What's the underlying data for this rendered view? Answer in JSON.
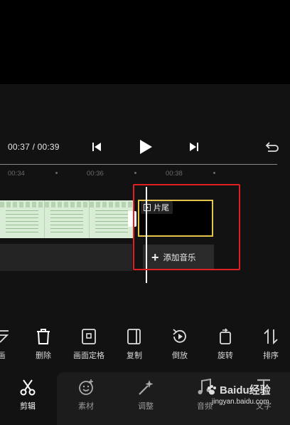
{
  "player": {
    "time_display": "00:37 / 00:39",
    "ruler_ticks": [
      "00:34",
      "00:36",
      "00:38"
    ]
  },
  "timeline": {
    "tail_label": "片尾",
    "add_music_label": "添加音乐",
    "accent_yellow": "#e6c34a",
    "highlight_red": "#e02020"
  },
  "toolbar": {
    "items": [
      {
        "label": "画",
        "icon": "partial-icon"
      },
      {
        "label": "删除",
        "icon": "trash-icon"
      },
      {
        "label": "画面定格",
        "icon": "freeze-frame-icon"
      },
      {
        "label": "复制",
        "icon": "copy-icon"
      },
      {
        "label": "倒放",
        "icon": "reverse-icon"
      },
      {
        "label": "旋转",
        "icon": "rotate-icon"
      },
      {
        "label": "排序",
        "icon": "sort-icon"
      }
    ]
  },
  "bottom_tabs": [
    {
      "label": "剪辑",
      "icon": "scissors-icon",
      "active": true
    },
    {
      "label": "素材",
      "icon": "sticker-icon",
      "active": false
    },
    {
      "label": "调整",
      "icon": "magic-wand-icon",
      "active": false
    },
    {
      "label": "音频",
      "icon": "music-note-icon",
      "active": false
    },
    {
      "label": "文字",
      "icon": "text-icon",
      "active": false
    }
  ],
  "watermark": {
    "brand": "Baidu经验",
    "url": "jingyan.baidu.com"
  }
}
